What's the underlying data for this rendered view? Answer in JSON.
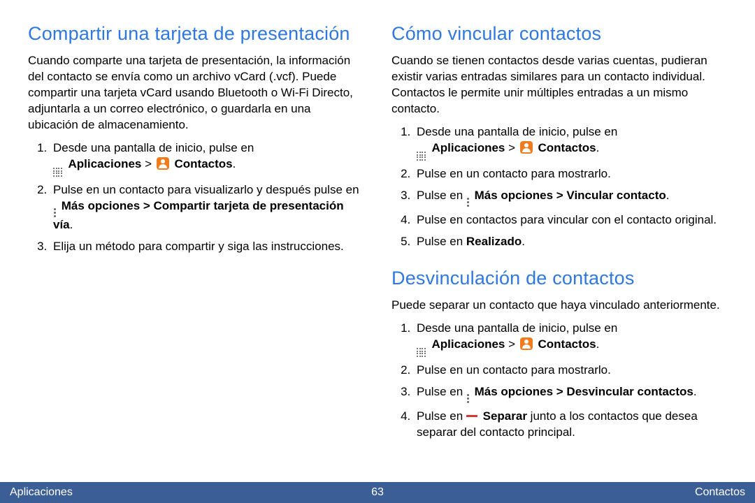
{
  "left": {
    "h1": "Compartir una tarjeta de presentación",
    "p1": "Cuando comparte una tarjeta de presentación, la información del contacto se envía como un archivo vCard (.vcf). Puede compartir una tarjeta vCard usando Bluetooth o Wi-Fi Directo, adjuntarla a un correo electrónico, o guardarla en una ubicación de almacenamiento.",
    "li1a": "Desde una pantalla de inicio, pulse en",
    "li1b": "Aplicaciones",
    "li1gt": " > ",
    "li1c": "Contactos",
    "li2a": "Pulse en un contacto para visualizarlo y después pulse en ",
    "li2b": "Más opciones > Compartir tarjeta de presentación vía",
    "li3": "Elija un método para compartir y siga las instrucciones."
  },
  "rightTop": {
    "h1": "Cómo vincular contactos",
    "p1": "Cuando se tienen contactos desde varias cuentas, pudieran existir varias entradas similares para un contacto individual. Contactos le permite unir múltiples entradas a un mismo contacto.",
    "li1a": "Desde una pantalla de inicio, pulse en",
    "li1b": "Aplicaciones",
    "li1gt": " > ",
    "li1c": "Contactos",
    "li2": "Pulse en un contacto para mostrarlo.",
    "li3a": "Pulse en ",
    "li3b": "Más opciones > Vincular contacto",
    "li4": "Pulse en contactos para vincular con el contacto original.",
    "li5a": "Pulse en ",
    "li5b": "Realizado"
  },
  "rightBot": {
    "h1": "Desvinculación de contactos",
    "p1": "Puede separar un contacto que haya vinculado anteriormente.",
    "li1a": "Desde una pantalla de inicio, pulse en",
    "li1b": "Aplicaciones",
    "li1gt": " > ",
    "li1c": "Contactos",
    "li2": "Pulse en un contacto para mostrarlo.",
    "li3a": "Pulse en ",
    "li3b": "Más opciones > Desvincular contactos",
    "li4a": "Pulse en ",
    "li4b": "Separar",
    "li4c": " junto a los contactos que desea separar del contacto principal."
  },
  "footer": {
    "left": "Aplicaciones",
    "page": "63",
    "right": "Contactos"
  }
}
